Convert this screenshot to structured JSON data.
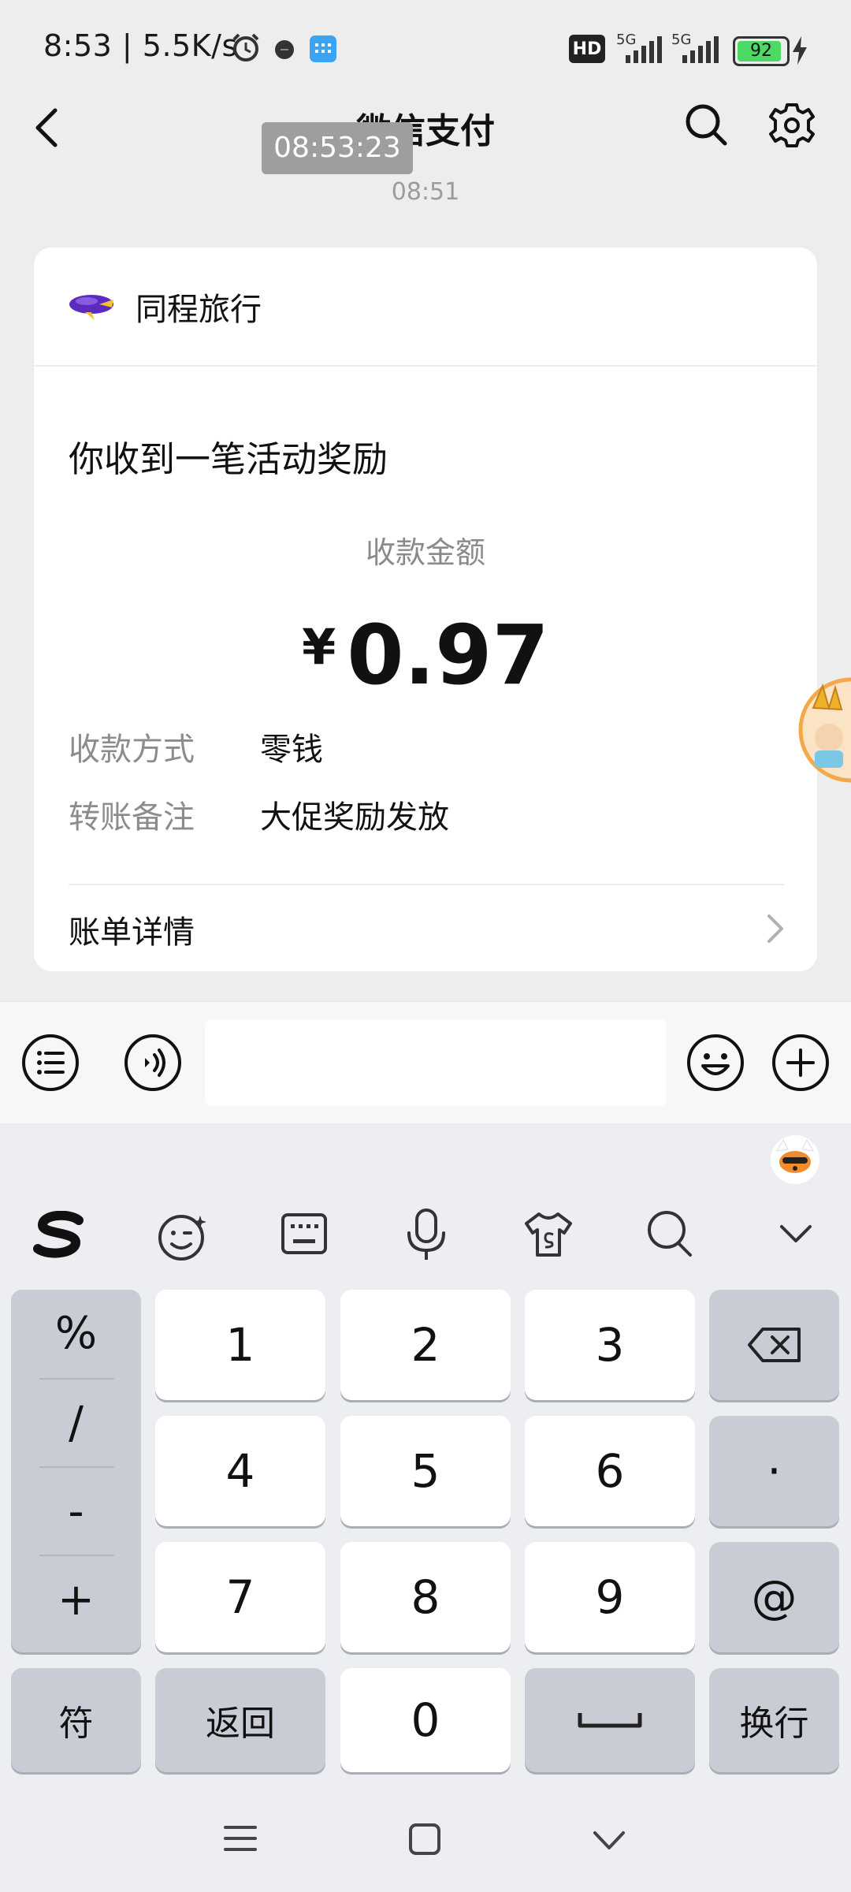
{
  "status_bar": {
    "time_speed": "8:53 | 5.5K/s",
    "network_1": "5G",
    "network_2": "5G",
    "hd_label": "HD",
    "battery": "92"
  },
  "header": {
    "title": "微信支付",
    "timestamp_overlay": "08:53:23"
  },
  "chat": {
    "time": "08:51"
  },
  "card": {
    "merchant": "同程旅行",
    "headline": "你收到一笔活动奖励",
    "amount_label": "收款金额",
    "currency": "¥",
    "amount": "0.97",
    "rows": [
      {
        "label": "收款方式",
        "value": "零钱"
      },
      {
        "label": "转账备注",
        "value": "大促奖励发放"
      }
    ],
    "bill_detail": "账单详情"
  },
  "keyboard": {
    "symbols": [
      "%",
      "/",
      "-",
      "+"
    ],
    "digits": [
      "1",
      "2",
      "3",
      "4",
      "5",
      "6",
      "7",
      "8",
      "9",
      "0"
    ],
    "dot": "·",
    "at": "@",
    "fu": "符",
    "back": "返回",
    "enter": "换行"
  },
  "colors": {
    "page_bg": "#ededed",
    "keyboard_bg": "#eceef2",
    "key_gray": "#c9ccd4",
    "merchant_logo": "#5b2bbf"
  }
}
